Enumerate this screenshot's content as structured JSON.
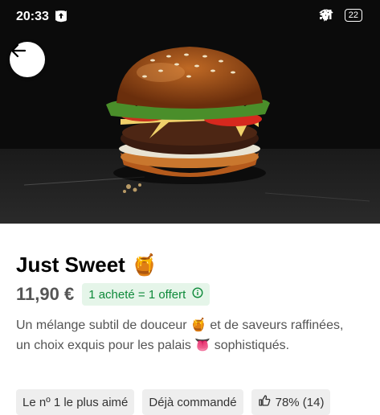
{
  "status_bar": {
    "time": "20:33",
    "battery": "22",
    "left_icons": [
      "notifications-off-icon",
      "alarm-icon",
      "gmail-icon",
      "instagram-icon",
      "upload-icon"
    ],
    "right_icons": [
      "location-icon",
      "bluetooth-icon",
      "signal-icon",
      "wifi-icon",
      "battery-icon"
    ]
  },
  "product": {
    "name": "Just Sweet",
    "name_emoji": "🍯",
    "price": "11,90 €",
    "promo": "1 acheté = 1 offert",
    "promo_icon": "info-icon",
    "description": "Un mélange subtil de douceur 🍯 et de saveurs raffinées, un choix exquis pour les palais 👅 sophistiqués."
  },
  "tags": [
    {
      "label": "Le nº 1 le plus aimé"
    },
    {
      "label": "Déjà commandé"
    },
    {
      "label": "78% (14)",
      "icon": "thumbs-up-icon"
    }
  ],
  "colors": {
    "promo_bg": "#e5f5e9",
    "promo_text": "#0e8a3a",
    "tag_bg": "#eeeeee"
  }
}
